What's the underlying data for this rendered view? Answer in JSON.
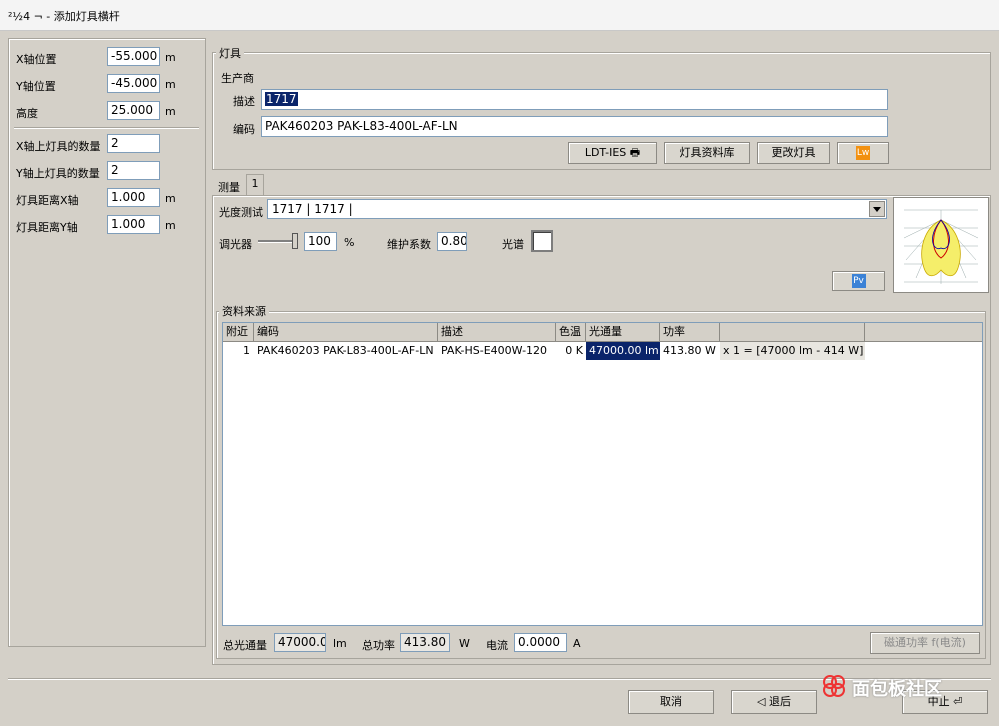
{
  "window": {
    "title": "²½4 ¬ - 添加灯具横杆"
  },
  "left_panel": {
    "fields": [
      {
        "label": "X轴位置",
        "value": "-55.000",
        "unit": "m"
      },
      {
        "label": "Y轴位置",
        "value": "-45.000",
        "unit": "m"
      },
      {
        "label": "高度",
        "value": "25.000",
        "unit": "m"
      },
      {
        "label": "X轴上灯具的数量",
        "value": "2",
        "unit": ""
      },
      {
        "label": "Y轴上灯具的数量",
        "value": "2",
        "unit": ""
      },
      {
        "label": "灯具距离X轴",
        "value": "1.000",
        "unit": "m"
      },
      {
        "label": "灯具距离Y轴",
        "value": "1.000",
        "unit": "m"
      }
    ]
  },
  "luminaire": {
    "group_title": "灯具",
    "manufacturer_label": "生产商",
    "description_label": "描述",
    "description_value": "1717",
    "code_label": "编码",
    "code_value": "PAK460203 PAK-L83-400L-AF-LN",
    "buttons": {
      "ldt_ies": "LDT-IES",
      "library": "灯具资料库",
      "change": "更改灯具",
      "lw": "Lw"
    }
  },
  "measure": {
    "tab_label": "测量",
    "tab_index": "1",
    "photometry_label": "光度测试",
    "photometry_value": "1717 | 1717 |",
    "dimmer_label": "调光器",
    "dimmer_value": "100",
    "dimmer_unit": "%",
    "dimmer_level": 1.0,
    "maintenance_label": "维护系数",
    "maintenance_value": "0.80",
    "spectrum_label": "光谱",
    "pv_label": "Pv"
  },
  "source": {
    "group_title": "资料来源",
    "columns": [
      "附近",
      "编码",
      "描述",
      "色温",
      "光通量",
      "功率",
      ""
    ],
    "rows": [
      {
        "index": "1",
        "code": "PAK460203 PAK-L83-400L-AF-LN",
        "desc": "PAK-HS-E400W-120",
        "cct": "0 K",
        "flux": "47000.00 lm",
        "power": "413.80 W",
        "formula": "x 1 = [47000 lm - 414 W]"
      }
    ]
  },
  "totals": {
    "flux_label": "总光通量",
    "flux_value": "47000.00",
    "flux_unit": "lm",
    "power_label": "总功率",
    "power_value": "413.80",
    "power_unit": "W",
    "current_label": "电流",
    "current_value": "0.0000",
    "current_unit": "A",
    "power_func_button": "磁通功率 f(电流)"
  },
  "footer": {
    "cancel": "取消",
    "back": "退后",
    "finish": "中止"
  },
  "watermark": {
    "text": "面包板社区"
  },
  "colors": {
    "selection": "#0a246a",
    "face": "#d4d0c8"
  }
}
